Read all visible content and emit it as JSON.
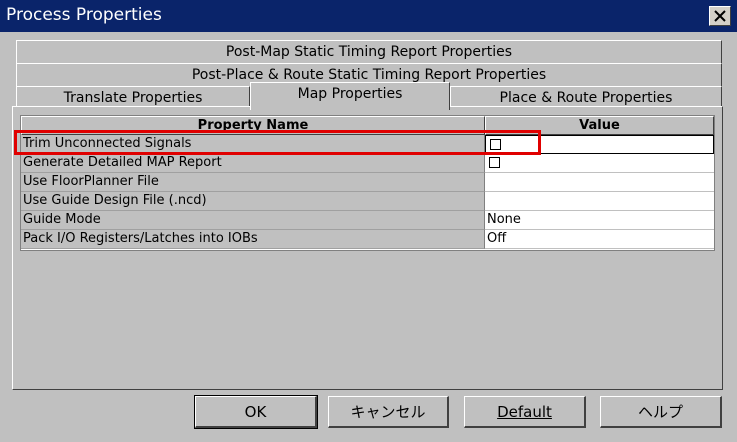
{
  "window": {
    "title": "Process Properties"
  },
  "tabs": {
    "row1": "Post-Map Static Timing Report Properties",
    "row2": "Post-Place & Route Static Timing Report Properties",
    "translate": "Translate Properties",
    "map": "Map Properties",
    "place_route": "Place & Route Properties"
  },
  "grid": {
    "headers": {
      "name": "Property Name",
      "value": "Value"
    },
    "rows": [
      {
        "name": "Trim Unconnected Signals",
        "value": "",
        "type": "checkbox",
        "checked": false
      },
      {
        "name": "Generate Detailed MAP Report",
        "value": "",
        "type": "checkbox",
        "checked": false
      },
      {
        "name": "Use FloorPlanner File",
        "value": "",
        "type": "text"
      },
      {
        "name": "Use Guide Design File (.ncd)",
        "value": "",
        "type": "text"
      },
      {
        "name": "Guide Mode",
        "value": "None",
        "type": "text"
      },
      {
        "name": "Pack I/O Registers/Latches into IOBs",
        "value": "Off",
        "type": "text"
      }
    ]
  },
  "buttons": {
    "ok": "OK",
    "cancel": "キャンセル",
    "default": "Default",
    "help": "ヘルプ"
  },
  "colors": {
    "title_bar": "#0a246a",
    "highlight": "#e00000",
    "face": "#c0c0c0"
  }
}
